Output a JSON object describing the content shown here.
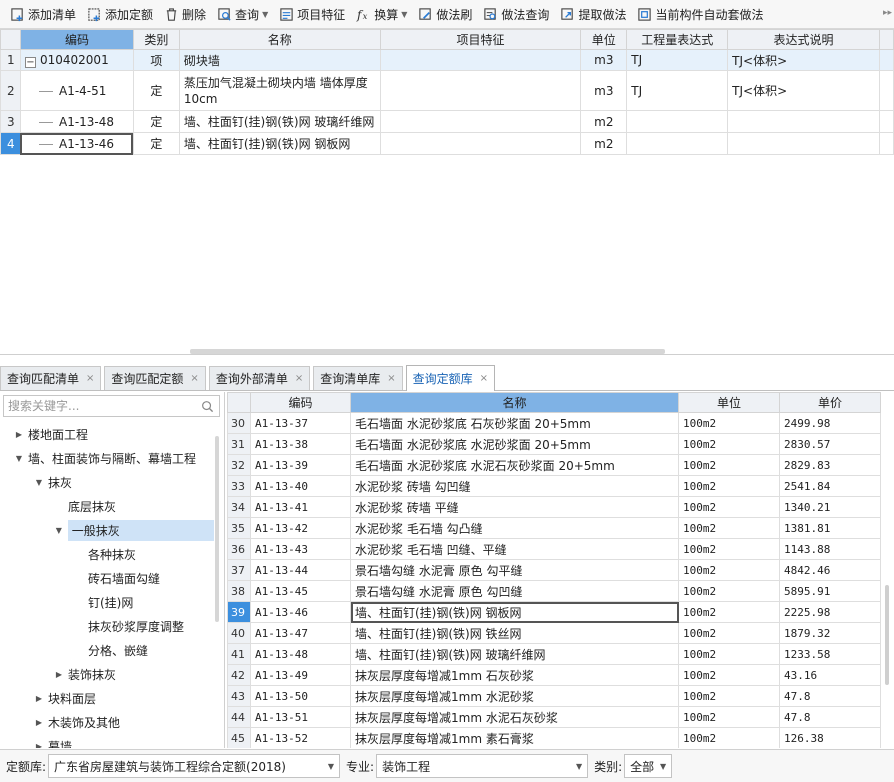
{
  "toolbar": {
    "items": [
      {
        "label": "添加清单",
        "icon": "add-list-icon"
      },
      {
        "label": "添加定额",
        "icon": "add-quota-icon"
      },
      {
        "label": "删除",
        "icon": "trash-icon"
      },
      {
        "label": "查询",
        "icon": "query-icon",
        "dropdown": true
      },
      {
        "label": "项目特征",
        "icon": "features-icon"
      },
      {
        "label": "换算",
        "icon": "fx-icon",
        "dropdown": true
      },
      {
        "label": "做法刷",
        "icon": "brush-icon"
      },
      {
        "label": "做法查询",
        "icon": "method-query-icon"
      },
      {
        "label": "提取做法",
        "icon": "extract-icon"
      },
      {
        "label": "当前构件自动套做法",
        "icon": "auto-apply-icon"
      }
    ]
  },
  "top_grid": {
    "columns": [
      "编码",
      "类别",
      "名称",
      "项目特征",
      "单位",
      "工程量表达式",
      "表达式说明"
    ],
    "rows": [
      {
        "num": "1",
        "code": "010402001",
        "type": "项",
        "name": "砌块墙",
        "feature": "",
        "unit": "m3",
        "expr": "TJ",
        "desc": "TJ<体积>"
      },
      {
        "num": "2",
        "code": "A1-4-51",
        "type": "定",
        "name": "蒸压加气混凝土砌块内墙 墙体厚度10cm",
        "feature": "",
        "unit": "m3",
        "expr": "TJ",
        "desc": "TJ<体积>"
      },
      {
        "num": "3",
        "code": "A1-13-48",
        "type": "定",
        "name": "墙、柱面钉(挂)钢(铁)网 玻璃纤维网",
        "feature": "",
        "unit": "m2",
        "expr": "",
        "desc": ""
      },
      {
        "num": "4",
        "code": "A1-13-46",
        "type": "定",
        "name": "墙、柱面钉(挂)钢(铁)网 钢板网",
        "feature": "",
        "unit": "m2",
        "expr": "",
        "desc": ""
      }
    ]
  },
  "tabs": [
    {
      "label": "查询匹配清单",
      "active": false
    },
    {
      "label": "查询匹配定额",
      "active": false
    },
    {
      "label": "查询外部清单",
      "active": false
    },
    {
      "label": "查询清单库",
      "active": false
    },
    {
      "label": "查询定额库",
      "active": true
    }
  ],
  "search": {
    "placeholder": "搜索关键字..."
  },
  "tree": [
    {
      "label": "楼地面工程",
      "level": 0,
      "arrow": "right"
    },
    {
      "label": "墙、柱面装饰与隔断、幕墙工程",
      "level": 0,
      "arrow": "down"
    },
    {
      "label": "抹灰",
      "level": 1,
      "arrow": "down"
    },
    {
      "label": "底层抹灰",
      "level": 2,
      "arrow": ""
    },
    {
      "label": "一般抹灰",
      "level": 2,
      "arrow": "down",
      "selected": true
    },
    {
      "label": "各种抹灰",
      "level": 3,
      "arrow": ""
    },
    {
      "label": "砖石墙面勾缝",
      "level": 3,
      "arrow": ""
    },
    {
      "label": "钉(挂)网",
      "level": 3,
      "arrow": ""
    },
    {
      "label": "抹灰砂浆厚度调整",
      "level": 3,
      "arrow": ""
    },
    {
      "label": "分格、嵌缝",
      "level": 3,
      "arrow": ""
    },
    {
      "label": "装饰抹灰",
      "level": 2,
      "arrow": "right"
    },
    {
      "label": "块料面层",
      "level": 1,
      "arrow": "right"
    },
    {
      "label": "木装饰及其他",
      "level": 1,
      "arrow": "right"
    },
    {
      "label": "幕墙",
      "level": 1,
      "arrow": "right"
    }
  ],
  "quota_grid": {
    "columns": [
      "编码",
      "名称",
      "单位",
      "单价"
    ],
    "rows": [
      {
        "num": "30",
        "code": "A1-13-37",
        "name": "毛石墙面 水泥砂浆底 石灰砂浆面 20+5mm",
        "unit": "100m2",
        "price": "2499.98"
      },
      {
        "num": "31",
        "code": "A1-13-38",
        "name": "毛石墙面 水泥砂浆底 水泥砂浆面 20+5mm",
        "unit": "100m2",
        "price": "2830.57"
      },
      {
        "num": "32",
        "code": "A1-13-39",
        "name": "毛石墙面 水泥砂浆底 水泥石灰砂浆面 20+5mm",
        "unit": "100m2",
        "price": "2829.83"
      },
      {
        "num": "33",
        "code": "A1-13-40",
        "name": "水泥砂浆 砖墙 勾凹缝",
        "unit": "100m2",
        "price": "2541.84"
      },
      {
        "num": "34",
        "code": "A1-13-41",
        "name": "水泥砂浆 砖墙 平缝",
        "unit": "100m2",
        "price": "1340.21"
      },
      {
        "num": "35",
        "code": "A1-13-42",
        "name": "水泥砂浆 毛石墙 勾凸缝",
        "unit": "100m2",
        "price": "1381.81"
      },
      {
        "num": "36",
        "code": "A1-13-43",
        "name": "水泥砂浆 毛石墙 凹缝、平缝",
        "unit": "100m2",
        "price": "1143.88"
      },
      {
        "num": "37",
        "code": "A1-13-44",
        "name": "景石墙勾缝 水泥膏 原色 勾平缝",
        "unit": "100m2",
        "price": "4842.46"
      },
      {
        "num": "38",
        "code": "A1-13-45",
        "name": "景石墙勾缝 水泥膏 原色 勾凹缝",
        "unit": "100m2",
        "price": "5895.91"
      },
      {
        "num": "39",
        "code": "A1-13-46",
        "name": "墙、柱面钉(挂)钢(铁)网 钢板网",
        "unit": "100m2",
        "price": "2225.98",
        "selected": true
      },
      {
        "num": "40",
        "code": "A1-13-47",
        "name": "墙、柱面钉(挂)钢(铁)网 铁丝网",
        "unit": "100m2",
        "price": "1879.32"
      },
      {
        "num": "41",
        "code": "A1-13-48",
        "name": "墙、柱面钉(挂)钢(铁)网 玻璃纤维网",
        "unit": "100m2",
        "price": "1233.58"
      },
      {
        "num": "42",
        "code": "A1-13-49",
        "name": "抹灰层厚度每增减1mm 石灰砂浆",
        "unit": "100m2",
        "price": "43.16"
      },
      {
        "num": "43",
        "code": "A1-13-50",
        "name": "抹灰层厚度每增减1mm 水泥砂浆",
        "unit": "100m2",
        "price": "47.8"
      },
      {
        "num": "44",
        "code": "A1-13-51",
        "name": "抹灰层厚度每增减1mm 水泥石灰砂浆",
        "unit": "100m2",
        "price": "47.8"
      },
      {
        "num": "45",
        "code": "A1-13-52",
        "name": "抹灰层厚度每增减1mm 素石膏浆",
        "unit": "100m2",
        "price": "126.38"
      }
    ]
  },
  "bottom": {
    "quota_lib_label": "定额库:",
    "quota_lib_value": "广东省房屋建筑与装饰工程综合定额(2018)",
    "major_label": "专业:",
    "major_value": "装饰工程",
    "category_label": "类别:",
    "category_value": "全部"
  },
  "colors": {
    "selected_blue": "#3c8fde",
    "header_blue": "#7fb2e5",
    "highlight_row": "#e6f1fb"
  }
}
